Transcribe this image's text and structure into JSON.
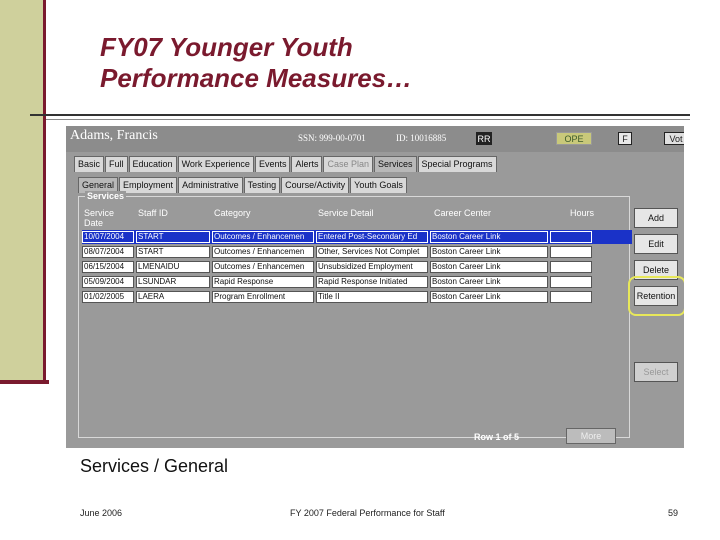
{
  "slide": {
    "title_line1": "FY07 Younger Youth",
    "title_line2": "Performance Measures…",
    "caption": "Services / General",
    "footer_date": "June 2006",
    "footer_center": "FY 2007 Federal Performance for Staff",
    "footer_page": "59"
  },
  "app": {
    "participant_name": "Adams, Francis",
    "ssn_text": "SSN: 999-00-0701",
    "id_text": "ID: 10016885",
    "badge_rr": "RR",
    "badge_pe": "OPE",
    "badge_f": "F",
    "badge_vote": "Vot",
    "tabs_top": [
      "Basic",
      "Full",
      "Education",
      "Work Experience",
      "Events",
      "Alerts",
      "Case Plan",
      "Services",
      "Special Programs"
    ],
    "tabs_sub": [
      "General",
      "Employment",
      "Administrative",
      "Testing",
      "Course/Activity",
      "Youth Goals"
    ],
    "group_label": "Services",
    "columns": [
      "Service Date",
      "Staff ID",
      "Category",
      "Service Detail",
      "Career Center",
      "Hours"
    ],
    "rows": [
      {
        "date": "10/07/2004",
        "staff": "START",
        "category": "Outcomes / Enhancemen",
        "detail": "Entered Post-Secondary Ed",
        "center": "Boston Career Link",
        "hours": ""
      },
      {
        "date": "08/07/2004",
        "staff": "START",
        "category": "Outcomes / Enhancemen",
        "detail": "Other, Services Not Complet",
        "center": "Boston Career Link",
        "hours": ""
      },
      {
        "date": "06/15/2004",
        "staff": "LMENAIDU",
        "category": "Outcomes / Enhancemen",
        "detail": "Unsubsidized Employment",
        "center": "Boston Career Link",
        "hours": ""
      },
      {
        "date": "05/09/2004",
        "staff": "LSUNDAR",
        "category": "Rapid Response",
        "detail": "Rapid Response Initiated",
        "center": "Boston Career Link",
        "hours": ""
      },
      {
        "date": "01/02/2005",
        "staff": "LAERA",
        "category": "Program Enrollment",
        "detail": "Title II",
        "center": "Boston Career Link",
        "hours": ""
      }
    ],
    "buttons": {
      "add": "Add",
      "edit": "Edit",
      "delete": "Delete",
      "retention": "Retention",
      "select": "Select",
      "more": "More"
    },
    "row_count": "Row 1 of 5"
  },
  "colors": {
    "title": "#7a1a2e",
    "left_bar": "#cfd09c",
    "selected_row": "#1a32c8",
    "highlight": "#e8e85a"
  }
}
